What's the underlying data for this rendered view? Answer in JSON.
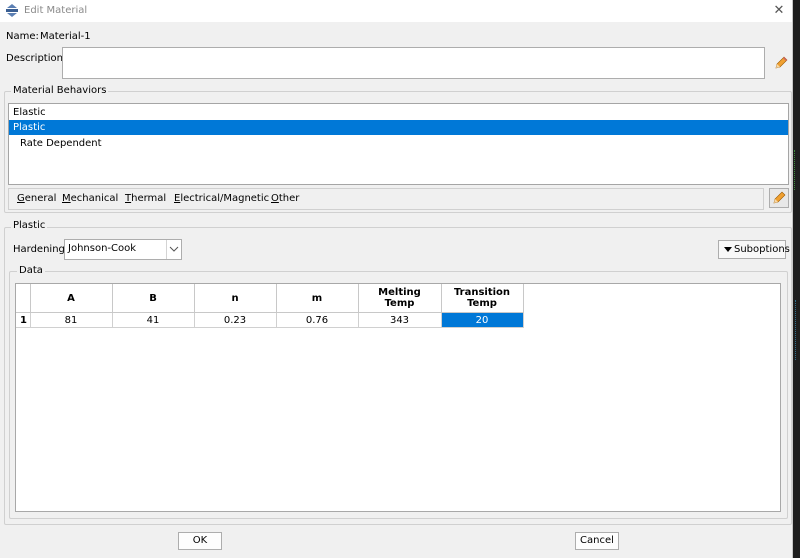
{
  "window": {
    "title": "Edit Material",
    "close_glyph": "✕"
  },
  "name": {
    "label": "Name:",
    "value": "Material-1"
  },
  "description": {
    "label": "Description:",
    "value": ""
  },
  "behaviors": {
    "title": "Material Behaviors",
    "items": [
      {
        "label": "Elastic",
        "selected": false
      },
      {
        "label": "Plastic",
        "selected": true
      },
      {
        "label": "Rate Dependent",
        "selected": false
      }
    ],
    "menus": [
      "General",
      "Mechanical",
      "Thermal",
      "Electrical/Magnetic",
      "Other"
    ]
  },
  "plastic": {
    "title": "Plastic",
    "hardening_label": "Hardening:",
    "hardening_value": "Johnson-Cook",
    "suboptions_label": "Suboptions"
  },
  "data": {
    "title": "Data",
    "columns": [
      "",
      "A",
      "B",
      "n",
      "m",
      "Melting\nTemp",
      "Transition\nTemp"
    ],
    "rows": [
      {
        "num": "1",
        "cells": [
          "81",
          "41",
          "0.23",
          "0.76",
          "343",
          "20"
        ]
      }
    ]
  },
  "buttons": {
    "ok": "OK",
    "cancel": "Cancel"
  },
  "colors": {
    "selection": "#0078d7",
    "background": "#f0f0f0"
  },
  "icons": {
    "title": "abaqus-material-icon",
    "edit": "pencil-icon"
  }
}
